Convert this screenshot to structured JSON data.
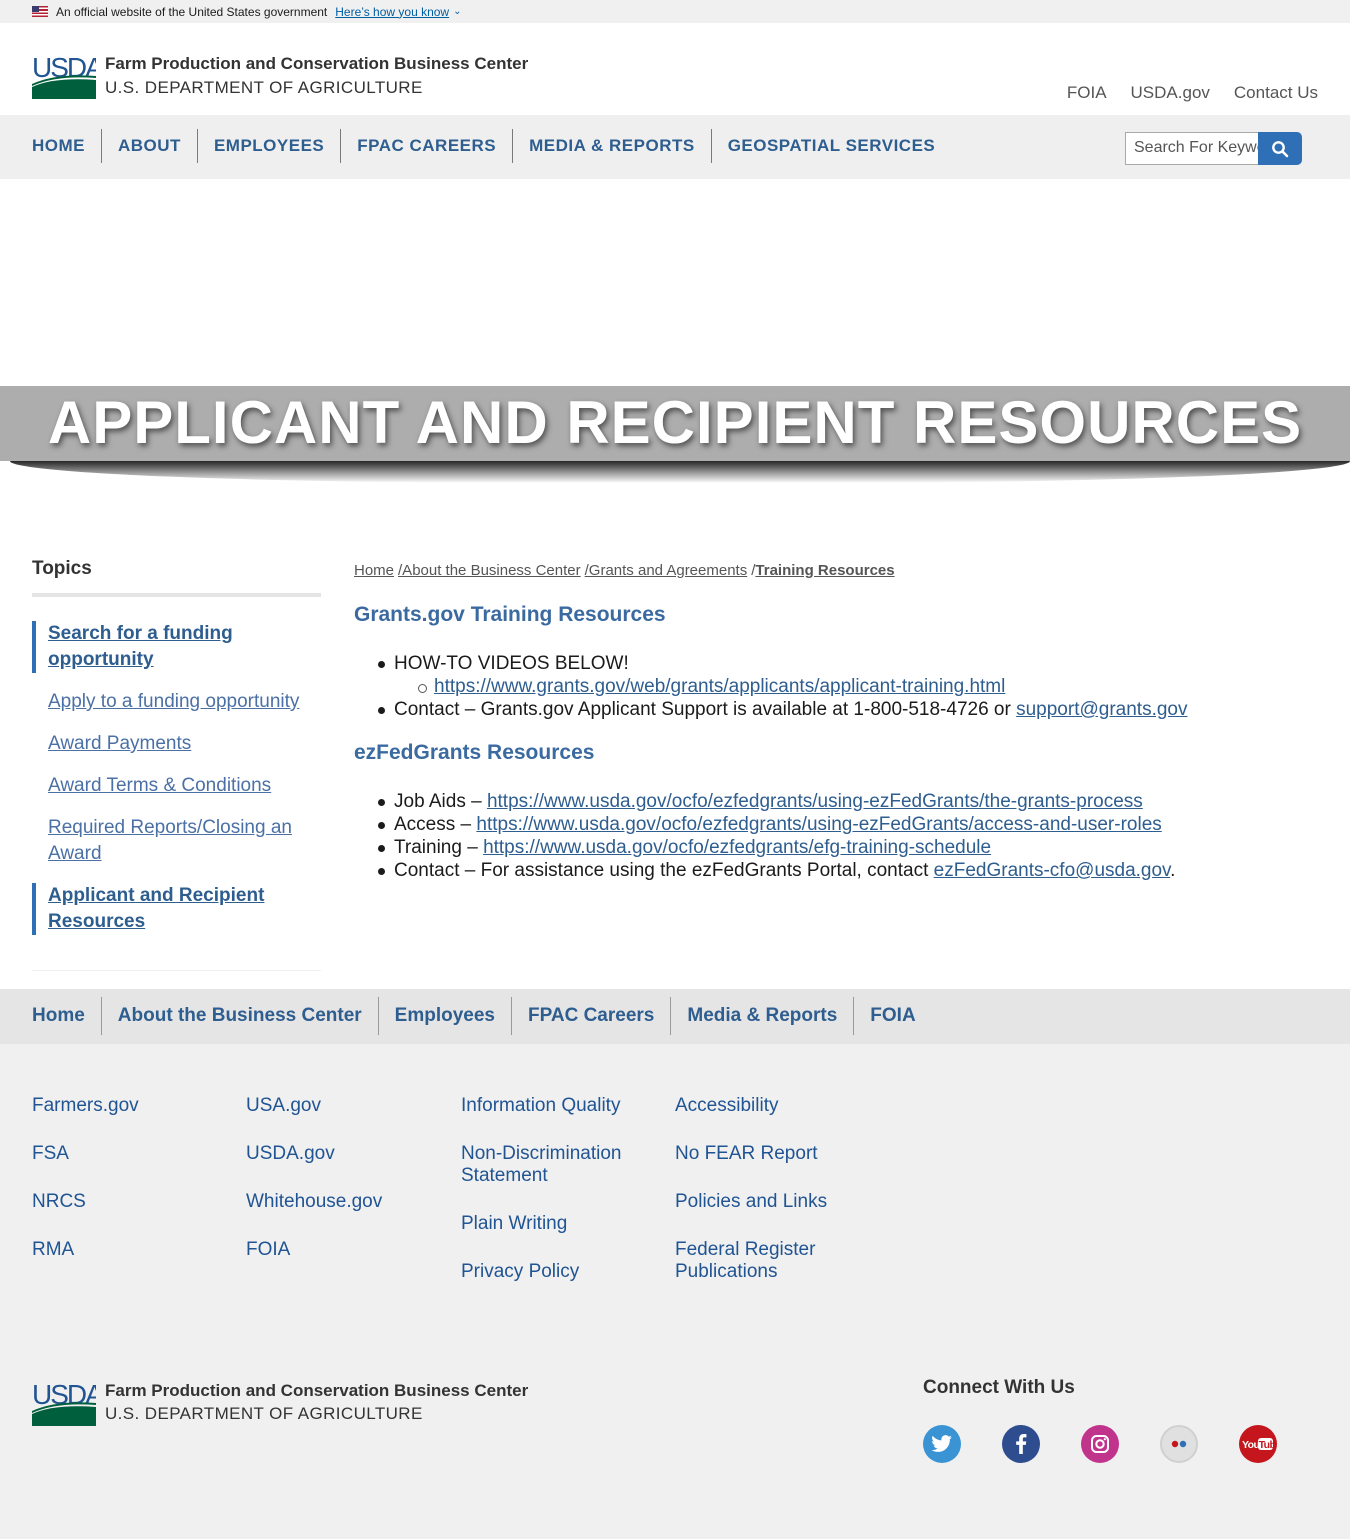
{
  "gov_banner": {
    "official_text": "An official website of the United States government",
    "how_text": "Here’s how you know"
  },
  "header": {
    "logo_text": "USDA",
    "agency_name": "Farm Production and Conservation Business Center",
    "department_name": "U.S. DEPARTMENT OF AGRICULTURE",
    "util_links": [
      "FOIA",
      "USDA.gov",
      "Contact Us"
    ]
  },
  "nav": {
    "items": [
      "HOME",
      "ABOUT",
      "EMPLOYEES",
      "FPAC CAREERS",
      "MEDIA & REPORTS",
      "GEOSPATIAL SERVICES"
    ],
    "search_placeholder": "Search For Keywords"
  },
  "hero": {
    "title": "APPLICANT AND RECIPIENT RESOURCES"
  },
  "sidebar": {
    "title": "Topics",
    "items": [
      {
        "label": "Search for a funding opportunity",
        "active": true
      },
      {
        "label": "Apply to a funding opportunity",
        "active": false
      },
      {
        "label": "Award Payments",
        "active": false
      },
      {
        "label": "Award Terms & Conditions",
        "active": false
      },
      {
        "label": "Required Reports/Closing an Award",
        "active": false
      },
      {
        "label": "Applicant and Recipient Resources",
        "active": true
      }
    ]
  },
  "breadcrumb": {
    "items": [
      "Home",
      "/About the Business Center",
      "/Grants and Agreements"
    ],
    "separator": "/",
    "current": "Training Resources"
  },
  "sections": {
    "grants_gov": {
      "title": "Grants.gov Training Resources",
      "videos_label": "HOW-TO VIDEOS BELOW!",
      "videos_link": "https://www.grants.gov/web/grants/applicants/applicant-training.html",
      "contact_text": "Contact – Grants.gov Applicant Support is available at 1-800-518-4726 or ",
      "contact_email": "support@grants.gov"
    },
    "ezfedgrants": {
      "title": "ezFedGrants Resources",
      "job_aids_label": "Job Aids – ",
      "job_aids_link": "https://www.usda.gov/ocfo/ezfedgrants/using-ezFedGrants/the-grants-process",
      "access_label": "Access – ",
      "access_link": "https://www.usda.gov/ocfo/ezfedgrants/using-ezFedGrants/access-and-user-roles",
      "training_label": "Training – ",
      "training_link": "https://www.usda.gov/ocfo/ezfedgrants/efg-training-schedule",
      "contact_text": "Contact – For assistance using the ezFedGrants Portal, contact ",
      "contact_email": "ezFedGrants-cfo@usda.gov",
      "contact_end": "."
    }
  },
  "footer_nav": {
    "items": [
      "Home",
      "About the Business Center",
      "Employees",
      "FPAC Careers",
      "Media & Reports",
      "FOIA"
    ]
  },
  "footer_links": {
    "col1": [
      "Farmers.gov",
      "FSA",
      "NRCS",
      "RMA"
    ],
    "col2": [
      "USA.gov",
      "USDA.gov",
      "Whitehouse.gov",
      "FOIA"
    ],
    "col3": [
      "Information Quality",
      "Non-Discrimination Statement",
      "Plain Writing",
      "Privacy Policy"
    ],
    "col4": [
      "Accessibility",
      "No FEAR Report",
      "Policies and Links",
      "Federal Register Publications"
    ]
  },
  "footer": {
    "logo_text": "USDA",
    "agency_name": "Farm Production and Conservation Business Center",
    "department_name": "U.S. DEPARTMENT OF AGRICULTURE",
    "connect_title": "Connect With Us",
    "social": [
      {
        "name": "twitter-icon",
        "color": "#3a93d3"
      },
      {
        "name": "facebook-icon",
        "color": "#2e4d8f"
      },
      {
        "name": "instagram-icon",
        "color": "#c1348b"
      },
      {
        "name": "flickr-icon",
        "color": "#e0e0e0"
      },
      {
        "name": "youtube-icon",
        "color": "#c4161c"
      }
    ]
  },
  "colors": {
    "brand_blue": "#205493",
    "nav_text": "#2e5d8f",
    "usda_green": "#005f3d",
    "hero_band": "#adadad"
  }
}
